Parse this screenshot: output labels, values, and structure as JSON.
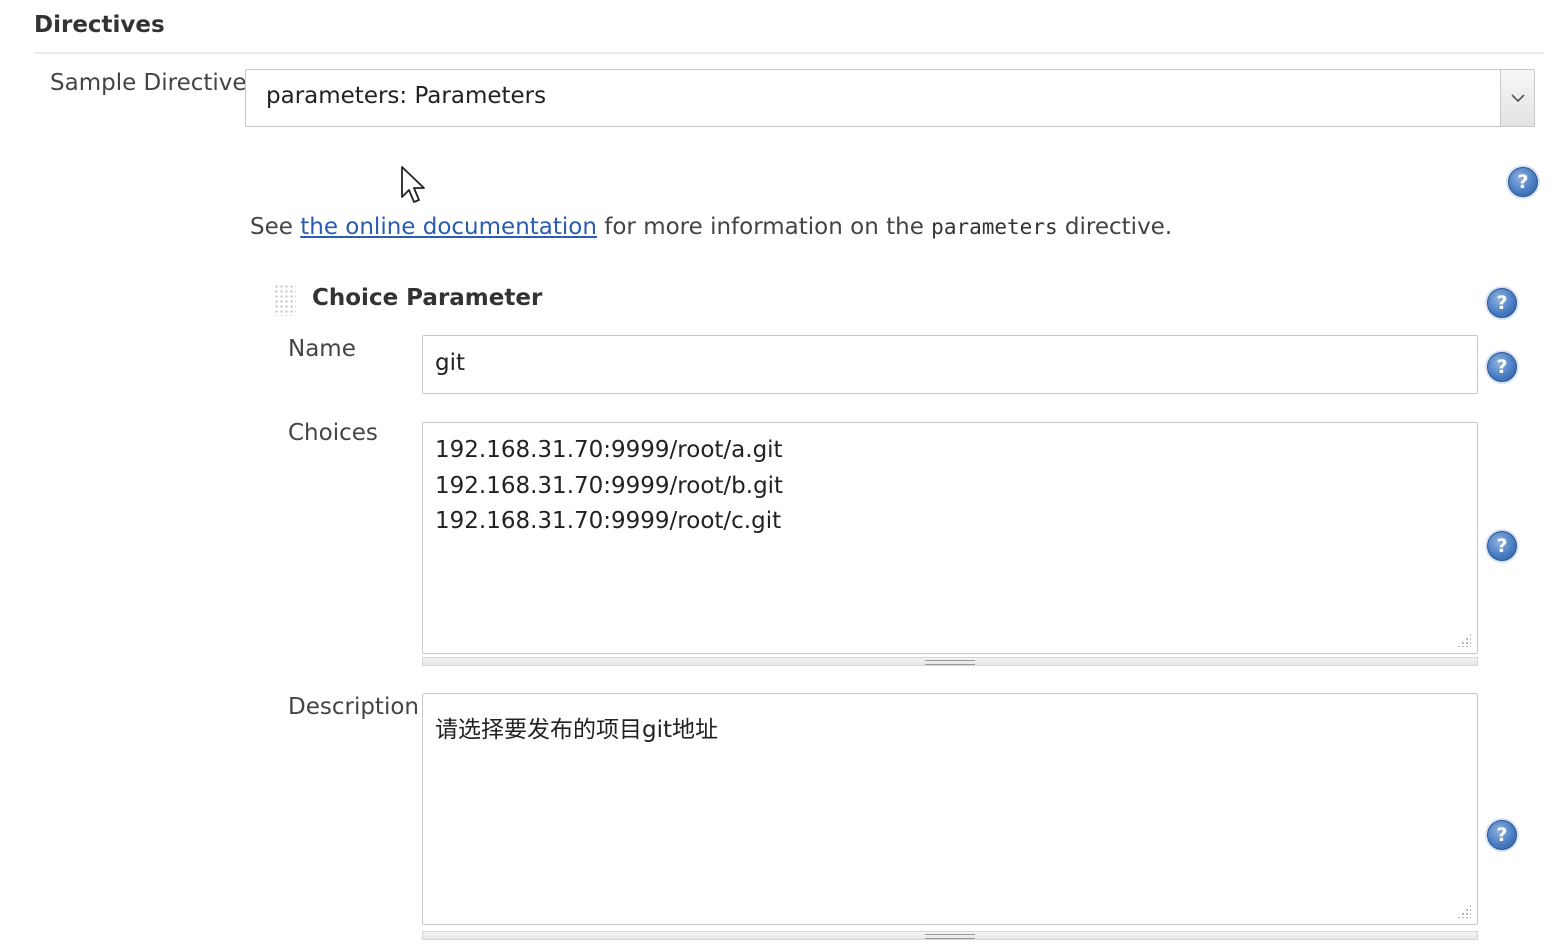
{
  "section": {
    "title": "Directives"
  },
  "sample_directive": {
    "label": "Sample Directive",
    "selected_value": "parameters: Parameters",
    "dropdown_icon": "chevron-down-icon"
  },
  "info": {
    "prefix": "See ",
    "link_text": "the online documentation",
    "middle": " for more information on the ",
    "code": "parameters",
    "suffix": " directive."
  },
  "choice_parameter": {
    "title": "Choice Parameter",
    "name_label": "Name",
    "name_value": "git",
    "choices_label": "Choices",
    "choices": [
      "192.168.31.70:9999/root/a.git",
      "192.168.31.70:9999/root/b.git",
      "192.168.31.70:9999/root/c.git"
    ],
    "description_label": "Description",
    "description_value": "请选择要发布的项目git地址"
  },
  "help_icon_glyph": "?",
  "colors": {
    "link": "#2a5db0",
    "help_icon": "#4a7ec3",
    "border": "#c9c9c9"
  }
}
